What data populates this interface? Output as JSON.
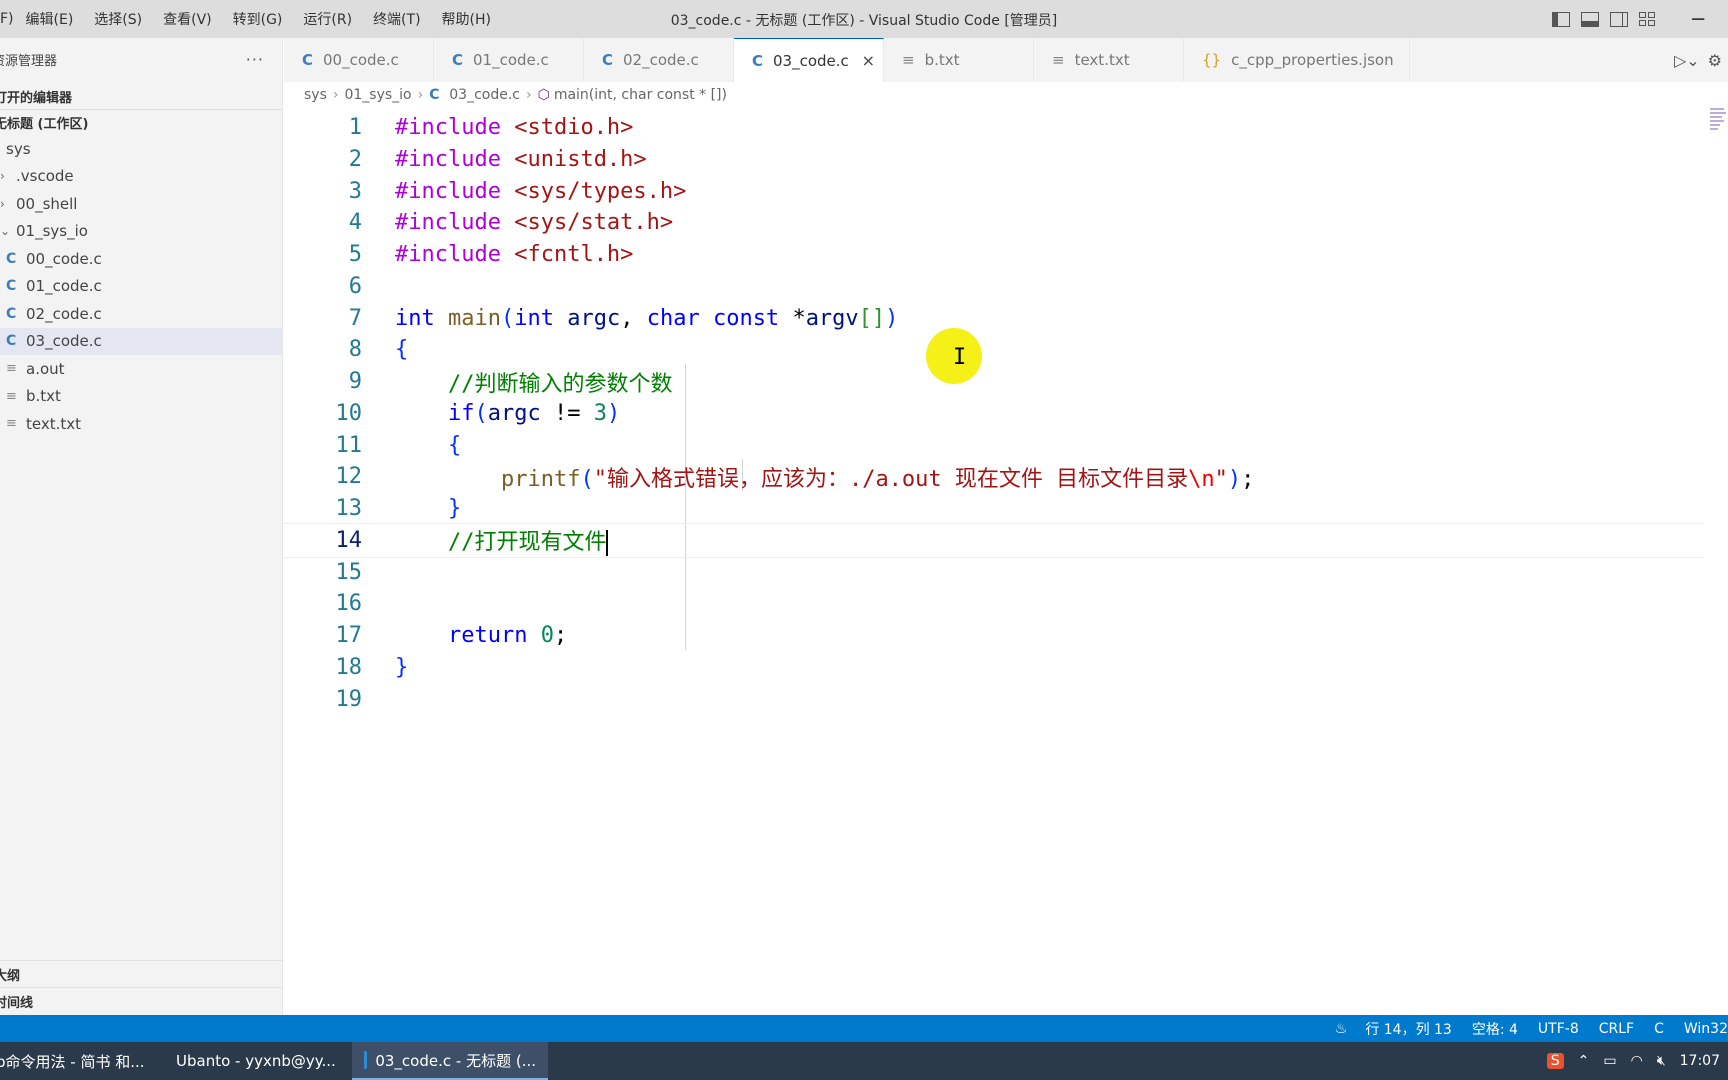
{
  "menu": [
    "F)",
    "编辑(E)",
    "选择(S)",
    "查看(V)",
    "转到(G)",
    "运行(R)",
    "终端(T)",
    "帮助(H)"
  ],
  "window_title": "03_code.c - 无标题 (工作区) - Visual Studio Code [管理员]",
  "sidebar": {
    "title": "资源管理器",
    "more": "···",
    "open_editors": "打开的编辑器",
    "workspace": "无标题 (工作区)",
    "items": [
      {
        "label": "sys",
        "kind": "folder-root"
      },
      {
        "label": ".vscode",
        "kind": "folder-collapsed"
      },
      {
        "label": "00_shell",
        "kind": "folder-collapsed"
      },
      {
        "label": "01_sys_io",
        "kind": "folder-expanded"
      },
      {
        "label": "00_code.c",
        "kind": "c"
      },
      {
        "label": "01_code.c",
        "kind": "c"
      },
      {
        "label": "02_code.c",
        "kind": "c"
      },
      {
        "label": "03_code.c",
        "kind": "c",
        "selected": true
      },
      {
        "label": "a.out",
        "kind": "txt"
      },
      {
        "label": "b.txt",
        "kind": "txt"
      },
      {
        "label": "text.txt",
        "kind": "txt"
      }
    ],
    "outline": "大纲",
    "timeline": "时间线"
  },
  "tabs": [
    {
      "label": "00_code.c",
      "icon": "C"
    },
    {
      "label": "01_code.c",
      "icon": "C"
    },
    {
      "label": "02_code.c",
      "icon": "C"
    },
    {
      "label": "03_code.c",
      "icon": "C",
      "active": true,
      "close": "×"
    },
    {
      "label": "b.txt",
      "icon": "≡"
    },
    {
      "label": "text.txt",
      "icon": "≡"
    },
    {
      "label": "c_cpp_properties.json",
      "icon": "{}"
    }
  ],
  "breadcrumb": {
    "parts": [
      "sys",
      "01_sys_io",
      "03_code.c",
      "main(int, char const * [])"
    ]
  },
  "editor": {
    "current_line": 14,
    "lines": [
      "#include <stdio.h>",
      "#include <unistd.h>",
      "#include <sys/types.h>",
      "#include <sys/stat.h>",
      "#include <fcntl.h>",
      "",
      "int main(int argc, char const *argv[])",
      "{",
      "    //判断输入的参数个数",
      "    if(argc != 3)",
      "    {",
      "        printf(\"输入格式错误，应该为：./a.out 现在文件 目标文件目录\\n\");",
      "    }",
      "    //打开现有文件",
      "",
      "",
      "    return 0;",
      "}",
      ""
    ]
  },
  "status": {
    "position": "行 14，列 13",
    "spaces": "空格: 4",
    "encoding": "UTF-8",
    "eol": "CRLF",
    "language": "C",
    "platform": "Win32"
  },
  "taskbar": {
    "items": [
      {
        "label": "p命令用法 - 简书 和...",
        "icon_color": "#e8542f"
      },
      {
        "label": "Ubanto - yyxnb@yy...",
        "icon_color": "#d9534f"
      },
      {
        "label": "03_code.c - 无标题 (...",
        "icon_color": "#2c8fd6",
        "active": true
      }
    ],
    "clock": "17:07"
  },
  "colors": {
    "statusbar": "#007acc",
    "accent": "#005fb8",
    "mouse_highlight": "#f5ee00"
  }
}
